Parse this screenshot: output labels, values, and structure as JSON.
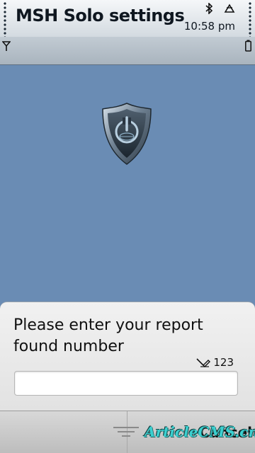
{
  "status_bar": {
    "title": "MSH Solo settings",
    "time": "10:58 pm",
    "icons": [
      "bluetooth-icon",
      "alert-icon",
      "signal-icon",
      "battery-icon"
    ]
  },
  "main": {
    "icon": "shield-power-icon"
  },
  "dialog": {
    "prompt": "Please enter your report found number",
    "input_mode": "123",
    "input_value": ""
  },
  "softkeys": {
    "right_label": "Cancel"
  },
  "watermark": "ArticleCMS.cn",
  "colors": {
    "background": "#6a8cb4",
    "dialog": "#e9e9e9",
    "watermark": "#3bd0d0"
  }
}
